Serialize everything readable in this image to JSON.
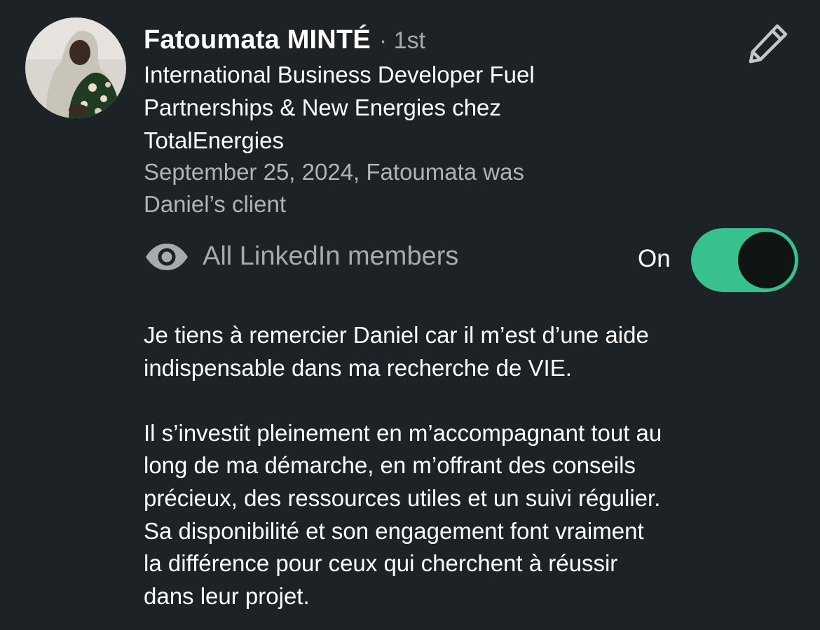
{
  "profile": {
    "name": "Fatoumata MINTÉ",
    "degree": "· 1st",
    "headline": [
      "International Business Developer Fuel",
      "Partnerships & New Energies chez",
      "TotalEnergies"
    ],
    "meta": [
      "September 25, 2024, Fatoumata was",
      "Daniel’s client"
    ],
    "avatar_icon": "profile-photo"
  },
  "edit": {
    "icon": "pencil-icon"
  },
  "visibility": {
    "icon": "eye-icon",
    "label": "All LinkedIn members",
    "toggle_label": "On",
    "toggle_on": true,
    "toggle_color": "#38c08e"
  },
  "recommendation": {
    "paragraphs": [
      [
        "Je tiens à remercier Daniel car il m’est d’une aide",
        "indispensable dans ma recherche de VIE."
      ],
      [
        "Il s’investit pleinement en m’accompagnant tout au",
        "long de ma démarche, en m’offrant des conseils",
        "précieux, des ressources utiles et un suivi régulier.",
        "Sa disponibilité et son engagement font vraiment",
        "la différence pour ceux qui cherchent à réussir",
        "dans leur projet."
      ]
    ]
  }
}
